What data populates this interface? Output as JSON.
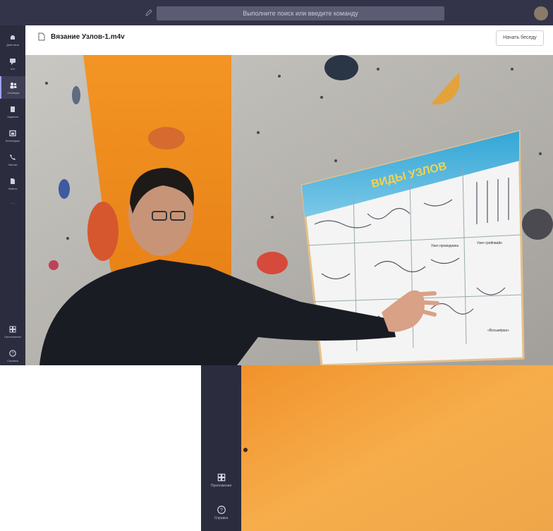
{
  "search": {
    "placeholder": "Выполните поиск или введите команду"
  },
  "header": {
    "file_name": "Вязание Узлов-1.m4v",
    "meet_button": "Начать беседу"
  },
  "rail": {
    "items": [
      {
        "label": "Действия",
        "icon": "bell-icon"
      },
      {
        "label": "Чат",
        "icon": "chat-icon"
      },
      {
        "label": "Команды",
        "icon": "teams-icon",
        "active": true
      },
      {
        "label": "Задания",
        "icon": "assignments-icon"
      },
      {
        "label": "Календарь",
        "icon": "calendar-icon"
      },
      {
        "label": "Звонки",
        "icon": "phone-icon"
      },
      {
        "label": "Файлы",
        "icon": "files-icon"
      },
      {
        "label": "···",
        "icon": "more-icon"
      }
    ],
    "bottom": [
      {
        "label": "Приложения",
        "icon": "apps-icon"
      },
      {
        "label": "Справка",
        "icon": "help-icon"
      }
    ]
  },
  "poster": {
    "title": "ВИДЫ УЗЛОВ",
    "captions": [
      "Узел проводника",
      "Узел грейпвайн",
      "«Восьмёрка»"
    ]
  },
  "rail2": {
    "items": [
      {
        "label": "Приложения",
        "icon": "apps-icon"
      },
      {
        "label": "Справка",
        "icon": "help-icon"
      }
    ]
  },
  "colors": {
    "rail": "#2b2c3e",
    "topbar": "#33344a",
    "accent": "#9ea2ff",
    "orange_panel": "#f08a1f"
  }
}
